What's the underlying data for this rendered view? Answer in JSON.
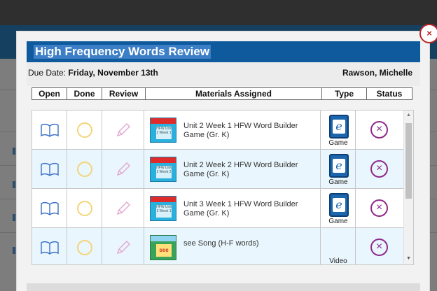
{
  "modal": {
    "title": "High Frequency Words Review",
    "due_label": "Due Date: ",
    "due_value": "Friday, November 13th",
    "owner": "Rawson, Michelle",
    "close_label": "×"
  },
  "columns": [
    "Open",
    "Done",
    "Review",
    "Materials Assigned",
    "Type",
    "Status"
  ],
  "rows": [
    {
      "material": "Unit 2 Week 1 HFW Word Builder Game (Gr. K)",
      "thumb_text": "HFW Unit 2 Week 1",
      "type": "Game",
      "status_icon": "remove-icon"
    },
    {
      "material": "Unit 2 Week 2 HFW Word Builder Game (Gr. K)",
      "thumb_text": "HFW Unit 2 Week 2",
      "type": "Game",
      "status_icon": "remove-icon"
    },
    {
      "material": "Unit 3 Week 1 HFW Word Builder Game (Gr. K)",
      "thumb_text": "HFW Unit 3 Week 1",
      "type": "Game",
      "status_icon": "remove-icon"
    },
    {
      "material": "see Song (H-F words)",
      "thumb_text": "see",
      "type": "Video",
      "status_icon": "remove-icon"
    }
  ],
  "colors": {
    "title_bar": "#0e5a9d",
    "row_alt": "#e9f6fd",
    "status_icon": "#8e2a8b",
    "e_icon": "#1b66ad"
  }
}
